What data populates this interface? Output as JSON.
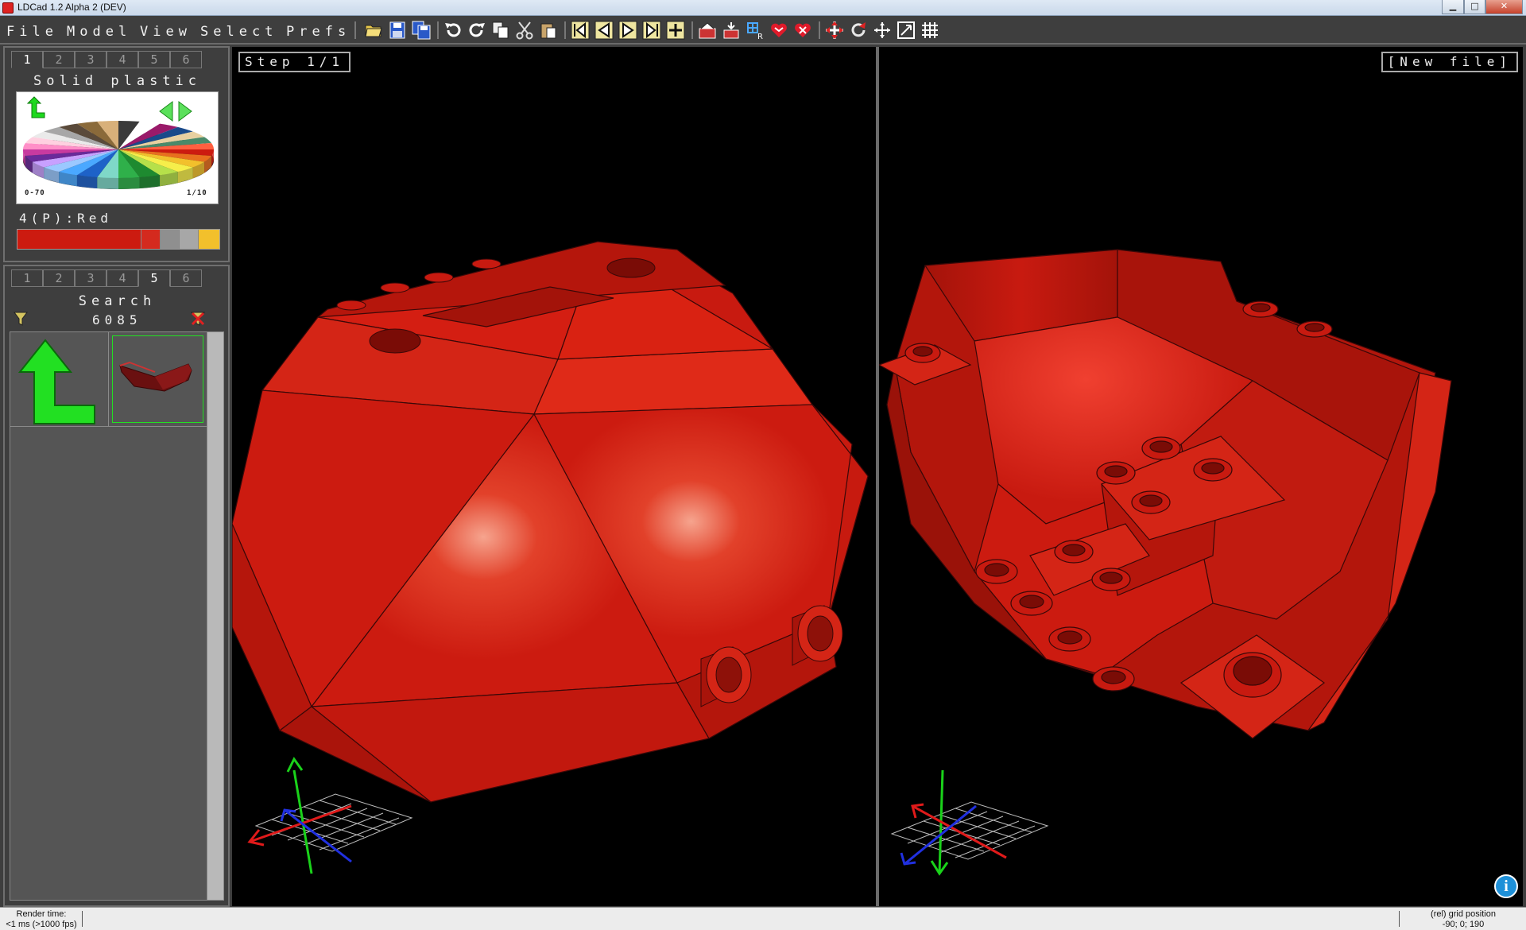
{
  "window": {
    "title": "LDCad 1.2 Alpha 2 (DEV)",
    "minimize_glyph": "▁",
    "maximize_glyph": "□",
    "close_glyph": "✕"
  },
  "menu": {
    "file": "File",
    "model": "Model",
    "view": "View",
    "select": "Select",
    "prefs": "Prefs"
  },
  "toolbar": {
    "icons": [
      "open-file-icon",
      "save-file-icon",
      "save-all-icon",
      "undo-icon",
      "redo-icon",
      "copy-icon",
      "cut-icon",
      "paste-icon",
      "first-step-icon",
      "prev-step-icon",
      "next-step-icon",
      "last-step-icon",
      "add-step-icon",
      "pivot-icon",
      "snap-icon",
      "grid-icon",
      "favorite-icon",
      "unfavorite-icon",
      "move-icon",
      "rotate-icon",
      "pan-icon",
      "nudge-icon",
      "mesh-icon"
    ]
  },
  "color_panel": {
    "tabs": [
      "1",
      "2",
      "3",
      "4",
      "5",
      "6"
    ],
    "active_tab": "1",
    "title": "Solid plastic",
    "palette_range_left": "0-70",
    "palette_range_right": "1/10",
    "selected_color": "4(P):Red",
    "swatches": [
      "#cc1b10",
      "#cc1b10",
      "#d42a1e",
      "#8f8f8f",
      "#a7a7a7",
      "#f2c02c"
    ]
  },
  "bin_panel": {
    "tabs": [
      "1",
      "2",
      "3",
      "4",
      "5",
      "6"
    ],
    "active_tab": "5",
    "title": "Search",
    "search_value": "6085"
  },
  "viewports": {
    "left_label": "Step 1/1",
    "right_label": "[New file]"
  },
  "status": {
    "render_time_label": "Render time:",
    "render_time_value": "<1 ms (>1000 fps)",
    "grid_pos_label": "(rel) grid position",
    "grid_pos_value": "-90; 0; 190"
  },
  "info_glyph": "i",
  "colors": {
    "part_red": "#cc1b10",
    "accent_green": "#22e022",
    "axis_red": "#e01a1a",
    "axis_green": "#1ad21a",
    "axis_blue": "#2030e0"
  }
}
